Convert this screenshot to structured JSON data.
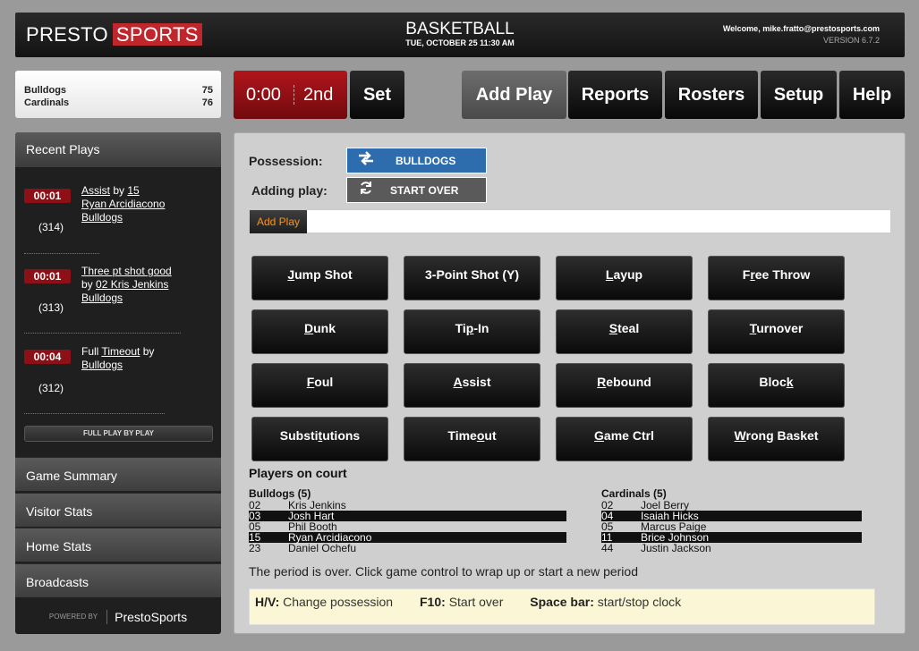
{
  "header": {
    "logo_left": "PRESTO",
    "logo_right": "SPORTS",
    "title": "BASKETBALL",
    "datetime": "TUE, OCTOBER 25 11:30 AM",
    "welcome": "Welcome, mike.fratto@prestosports.com",
    "version": "VERSION 6.7.2"
  },
  "scoreboard": {
    "teams": [
      {
        "name": "Bulldogs",
        "score": "75"
      },
      {
        "name": "Cardinals",
        "score": "76"
      }
    ]
  },
  "clock": {
    "time": "0:00",
    "period": "2nd"
  },
  "toolbar": {
    "set": "Set",
    "add_play": "Add Play",
    "reports": "Reports",
    "rosters": "Rosters",
    "setup": "Setup",
    "help": "Help"
  },
  "sidebar": {
    "recent_title": "Recent Plays",
    "plays": [
      {
        "time": "00:01",
        "num": "(314)",
        "lines": [
          "Assist by 15",
          "Ryan Arcidiacono",
          "Bulldogs"
        ]
      },
      {
        "time": "00:01",
        "num": "(313)",
        "lines": [
          "Three pt shot good",
          "by 02 Kris Jenkins",
          "Bulldogs"
        ]
      },
      {
        "time": "00:04",
        "num": "(312)",
        "lines": [
          "Full Timeout by",
          "Bulldogs"
        ]
      }
    ],
    "full_pbp": "FULL PLAY BY PLAY",
    "links": [
      "Game Summary",
      "Visitor Stats",
      "Home Stats",
      "Broadcasts"
    ],
    "powered_by": "POWERED BY",
    "powered_brand": "PrestoSports"
  },
  "main": {
    "possession_label": "Possession:",
    "possession_team": "BULLDOGS",
    "adding_label": "Adding play:",
    "start_over": "START OVER",
    "tab": "Add Play",
    "play_buttons": [
      "Jump Shot",
      "3-Point Shot (Y)",
      "Layup",
      "Free Throw",
      "Dunk",
      "Tip-In",
      "Steal",
      "Turnover",
      "Foul",
      "Assist",
      "Rebound",
      "Block",
      "Substitutions",
      "Timeout",
      "Game Ctrl",
      "Wrong Basket"
    ],
    "players_title": "Players on court",
    "visitor": {
      "name": "Bulldogs (5)",
      "players": [
        {
          "num": "02",
          "name": "Kris Jenkins"
        },
        {
          "num": "03",
          "name": "Josh Hart"
        },
        {
          "num": "05",
          "name": "Phil Booth"
        },
        {
          "num": "15",
          "name": "Ryan Arcidiacono"
        },
        {
          "num": "23",
          "name": "Daniel Ochefu"
        }
      ]
    },
    "home": {
      "name": "Cardinals (5)",
      "players": [
        {
          "num": "02",
          "name": "Joel Berry"
        },
        {
          "num": "04",
          "name": "Isaiah Hicks"
        },
        {
          "num": "05",
          "name": "Marcus Paige"
        },
        {
          "num": "11",
          "name": "Brice Johnson"
        },
        {
          "num": "44",
          "name": "Justin Jackson"
        }
      ]
    },
    "period_message": "The period is over. Click game control to wrap up or start a new period",
    "hints": [
      {
        "key": "H/V:",
        "text": "Change possession"
      },
      {
        "key": "F10:",
        "text": "Start over"
      },
      {
        "key": "Space bar:",
        "text": "start/stop clock"
      }
    ]
  },
  "colors": {
    "accent_red": "#c0272d",
    "possession_blue": "#2d6dae",
    "tab_orange": "#f7931e"
  }
}
